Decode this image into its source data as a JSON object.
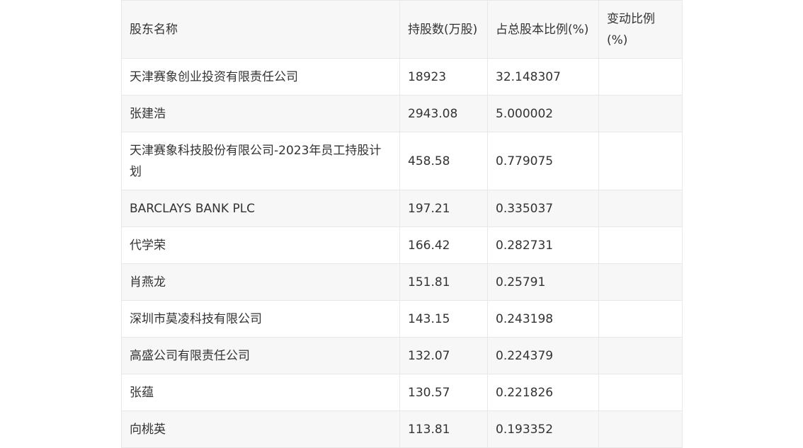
{
  "table": {
    "headers": [
      "股东名称",
      "持股数(万股)",
      "占总股本比例(%)",
      "变动比例(%)"
    ],
    "rows": [
      [
        "天津赛象创业投资有限责任公司",
        "18923",
        "32.148307",
        ""
      ],
      [
        "张建浩",
        "2943.08",
        "5.000002",
        ""
      ],
      [
        "天津赛象科技股份有限公司-2023年员工持股计划",
        "458.58",
        "0.779075",
        ""
      ],
      [
        "BARCLAYS BANK PLC",
        "197.21",
        "0.335037",
        ""
      ],
      [
        "代学荣",
        "166.42",
        "0.282731",
        ""
      ],
      [
        "肖燕龙",
        "151.81",
        "0.25791",
        ""
      ],
      [
        "深圳市莫凌科技有限公司",
        "143.15",
        "0.243198",
        ""
      ],
      [
        "高盛公司有限责任公司",
        "132.07",
        "0.224379",
        ""
      ],
      [
        "张蕴",
        "130.57",
        "0.221826",
        ""
      ],
      [
        "向桃英",
        "113.81",
        "0.193352",
        ""
      ]
    ]
  }
}
